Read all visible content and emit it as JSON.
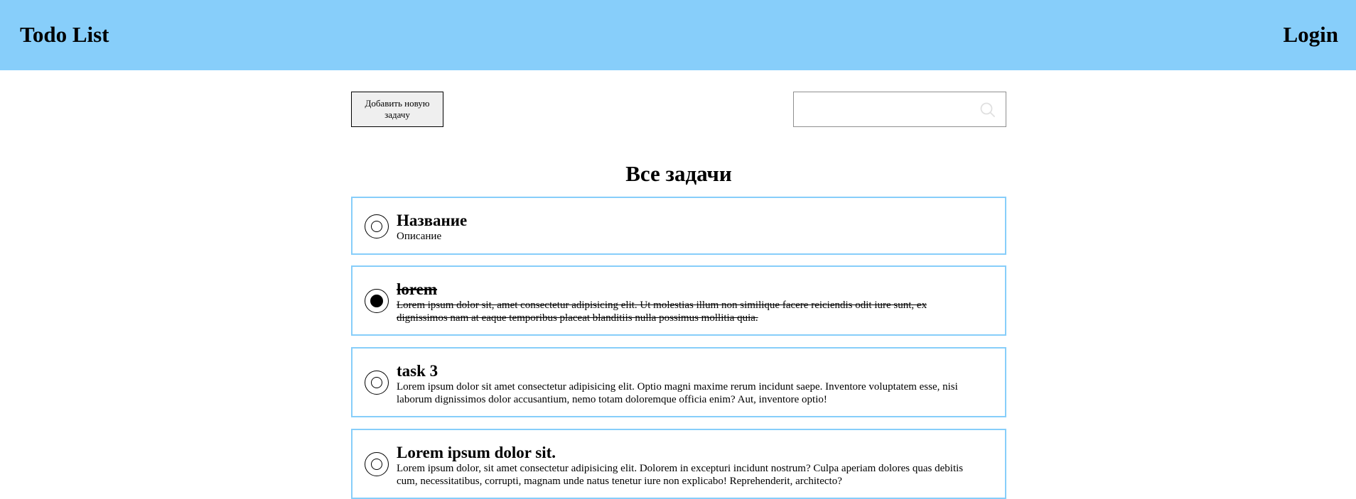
{
  "header": {
    "title": "Todo List",
    "login_label": "Login",
    "background_color": "#87cefa"
  },
  "toolbar": {
    "add_button_label": "Добавить новую задачу",
    "search": {
      "value": "",
      "placeholder": "",
      "icon": "search-icon"
    }
  },
  "main": {
    "section_title": "Все задачи",
    "tasks": [
      {
        "title": "Название",
        "description": "Описание",
        "completed": false
      },
      {
        "title": "lorem",
        "description": "Lorem ipsum dolor sit, amet consectetur adipisicing elit. Ut molestias illum non similique facere reiciendis odit iure sunt, ex dignissimos nam at eaque temporibus placeat blanditiis nulla possimus mollitia quia.",
        "completed": true
      },
      {
        "title": "task 3",
        "description": "Lorem ipsum dolor sit amet consectetur adipisicing elit. Optio magni maxime rerum incidunt saepe. Inventore voluptatem esse, nisi laborum dignissimos dolor accusantium, nemo totam doloremque officia enim? Aut, inventore optio!",
        "completed": false
      },
      {
        "title": "Lorem ipsum dolor sit.",
        "description": "Lorem ipsum dolor, sit amet consectetur adipisicing elit. Dolorem in excepturi incidunt nostrum? Culpa aperiam dolores quas debitis cum, necessitatibus, corrupti, magnam unde natus tenetur iure non explicabo! Reprehenderit, architecto?",
        "completed": false
      }
    ]
  }
}
